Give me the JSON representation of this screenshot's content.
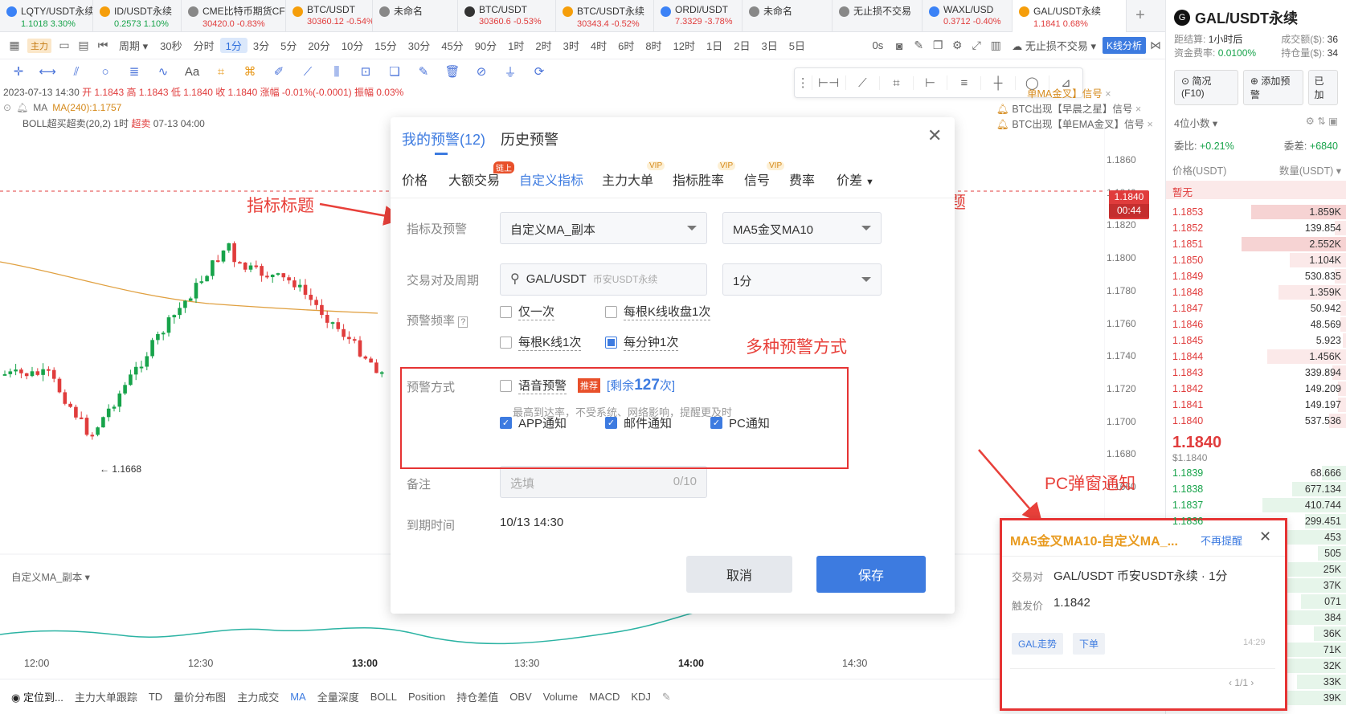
{
  "tabs": [
    {
      "name": "LQTY/USDT永续",
      "price": "1.1018",
      "change": "3.30%",
      "dir": "up",
      "color": "#3b82f6",
      "w": 116
    },
    {
      "name": "ID/USDT永续",
      "price": "0.2573",
      "change": "1.10%",
      "dir": "up",
      "color": "#f59e0b",
      "w": 110
    },
    {
      "name": "CME比特币期货CF",
      "price": "30420.0",
      "change": "-0.83%",
      "dir": "dn",
      "color": "#888",
      "w": 130
    },
    {
      "name": "BTC/USDT",
      "price": "30360.12",
      "change": "-0.54%",
      "dir": "dn",
      "color": "#f59e0b",
      "w": 108
    },
    {
      "name": "未命名",
      "price": "",
      "change": "",
      "dir": "",
      "color": "#888",
      "w": 106
    },
    {
      "name": "BTC/USDT",
      "price": "30360.6",
      "change": "-0.53%",
      "dir": "dn",
      "color": "#333",
      "w": 122
    },
    {
      "name": "BTC/USDT永续",
      "price": "30343.4",
      "change": "-0.52%",
      "dir": "dn",
      "color": "#f59e0b",
      "w": 122
    },
    {
      "name": "ORDI/USDT",
      "price": "7.3329",
      "change": "-3.78%",
      "dir": "dn",
      "color": "#3b82f6",
      "w": 110
    },
    {
      "name": "未命名",
      "price": "",
      "change": "",
      "dir": "",
      "color": "#888",
      "w": 112
    },
    {
      "name": "无止损不交易",
      "price": "",
      "change": "",
      "dir": "",
      "color": "#888",
      "w": 112
    },
    {
      "name": "WAXL/USD",
      "price": "0.3712",
      "change": "-0.40%",
      "dir": "dn",
      "color": "#3b82f6",
      "w": 112
    },
    {
      "name": "GAL/USDT永续",
      "price": "1.1841",
      "change": "0.68%",
      "dir": "dn",
      "color": "#f59e0b",
      "w": 142
    }
  ],
  "toolbar": {
    "main_label": "主力",
    "period_label": "周期",
    "intervals": [
      "30秒",
      "分时",
      "1分",
      "3分",
      "5分",
      "20分",
      "10分",
      "15分",
      "30分",
      "45分",
      "90分",
      "1时",
      "2时",
      "3时",
      "4时",
      "6时",
      "8时",
      "12时",
      "1日",
      "2日",
      "3日",
      "5日"
    ],
    "selected_interval": "1分",
    "seconds_label": "0s",
    "strategy_label": "无止损不交易",
    "kline_btn": "K线分析"
  },
  "legend": {
    "date": "2023-07-13 14:30",
    "ohlc": "开 1.1843 高 1.1843 低 1.1840 收 1.1840 涨幅 -0.01%(-0.0001) 振幅 0.03%",
    "ma_label": "MA",
    "ma_value": "MA(240):1.1757",
    "boll": "BOLL超买超卖(20,2) 1时",
    "boll_tag": "超卖",
    "boll_time": "07-13 04:00"
  },
  "signals": [
    "单MA金叉】信号",
    "BTC出现【早晨之星】信号",
    "BTC出现【单EMA金叉】信号"
  ],
  "price_axis": [
    "1.1860",
    "1.1840",
    "1.1820",
    "1.1800",
    "1.1780",
    "1.1760",
    "1.1740",
    "1.1720",
    "1.1700",
    "1.1680",
    "1.1660"
  ],
  "current_price": "1.1840",
  "countdown": "00:44",
  "low_marker": "1.1668",
  "sub_indicator": "自定义MA_副本",
  "time_axis": [
    "12:00",
    "12:30",
    "13:00",
    "13:30",
    "14:00",
    "14:30"
  ],
  "bottom_bar": [
    "定位到...",
    "主力大单跟踪",
    "TD",
    "量价分布图",
    "主力成交",
    "MA",
    "全量深度",
    "BOLL",
    "Position",
    "持仓差值",
    "OBV",
    "Volume",
    "MACD",
    "KDJ"
  ],
  "right_panel": {
    "title": "GAL/USDT永续",
    "settle_label": "距结算:",
    "settle_value": "1小时后",
    "volume_label": "成交额($):",
    "volume_value": "36",
    "fee_label": "资金费率:",
    "fee_value": "0.0100%",
    "oi_label": "持仓量($):",
    "oi_value": "34",
    "btn1": "简况(F10)",
    "btn2": "添加预警",
    "btn3": "已加",
    "decimals": "4位小数",
    "ratio_label": "委比:",
    "ratio_value": "+0.21%",
    "diff_label": "委差:",
    "diff_value": "+6840",
    "col_price": "价格(USDT)",
    "col_qty": "数量(USDT)",
    "none_label": "暂无",
    "asks": [
      {
        "p": "1.1853",
        "q": "1.859K",
        "w": 0.84,
        "hl": 1
      },
      {
        "p": "1.1852",
        "q": "139.854",
        "w": 0.1,
        "hl": 0
      },
      {
        "p": "1.1851",
        "q": "2.552K",
        "w": 0.93,
        "hl": 1
      },
      {
        "p": "1.1850",
        "q": "1.104K",
        "w": 0.5,
        "hl": 0
      },
      {
        "p": "1.1849",
        "q": "530.835",
        "w": 0.1,
        "hl": 0
      },
      {
        "p": "1.1848",
        "q": "1.359K",
        "w": 0.6,
        "hl": 0
      },
      {
        "p": "1.1847",
        "q": "50.942",
        "w": 0.05,
        "hl": 0
      },
      {
        "p": "1.1846",
        "q": "48.569",
        "w": 0.05,
        "hl": 0
      },
      {
        "p": "1.1845",
        "q": "5.923",
        "w": 0.03,
        "hl": 0
      },
      {
        "p": "1.1844",
        "q": "1.456K",
        "w": 0.7,
        "hl": 0
      },
      {
        "p": "1.1843",
        "q": "339.894",
        "w": 0.12,
        "hl": 0
      },
      {
        "p": "1.1842",
        "q": "149.209",
        "w": 0.07,
        "hl": 0
      },
      {
        "p": "1.1841",
        "q": "149.197",
        "w": 0.07,
        "hl": 0
      },
      {
        "p": "1.1840",
        "q": "537.536",
        "w": 0.15,
        "hl": 0
      }
    ],
    "last_price": "1.1840",
    "last_usd": "$1.1840",
    "bids": [
      {
        "p": "1.1839",
        "q": "68.666"
      },
      {
        "p": "1.1838",
        "q": "677.134"
      },
      {
        "p": "1.1837",
        "q": "410.744"
      },
      {
        "p": "1.1836",
        "q": "299.451"
      },
      {
        "p": "",
        "q": "453"
      },
      {
        "p": "",
        "q": "505"
      },
      {
        "p": "",
        "q": "25K"
      },
      {
        "p": "",
        "q": "37K"
      },
      {
        "p": "",
        "q": "071"
      },
      {
        "p": "",
        "q": "384"
      },
      {
        "p": "",
        "q": "36K"
      },
      {
        "p": "",
        "q": "71K"
      },
      {
        "p": "",
        "q": "32K"
      },
      {
        "p": "",
        "q": "33K"
      },
      {
        "p": "",
        "q": "39K"
      }
    ]
  },
  "dialog": {
    "tab_active": "我的预警(12)",
    "tab_history": "历史预警",
    "subtabs": [
      "价格",
      "大额交易",
      "自定义指标",
      "主力大单",
      "指标胜率",
      "信号",
      "费率",
      "价差"
    ],
    "badge_chain": "链上",
    "badge_vip": "VIP",
    "indicator_label": "指标及预警",
    "indicator_value": "自定义MA_副本",
    "alert_title_value": "MA5金叉MA10",
    "pair_label": "交易对及周期",
    "pair_value": "GAL/USDT",
    "pair_sub": "币安USDT永续",
    "period_value": "1分",
    "freq_label": "预警频率",
    "freq_options": [
      {
        "text": "仅一次",
        "state": "off"
      },
      {
        "text": "每根K线收盘1次",
        "state": "off"
      },
      {
        "text": "每根K线1次",
        "state": "off"
      },
      {
        "text": "每分钟1次",
        "state": "half"
      }
    ],
    "method_label": "预警方式",
    "voice_label": "语音预警",
    "recommend": "推荐",
    "remain_prefix": "[剩余",
    "remain_count": "127",
    "remain_suffix": "次]",
    "voice_hint": "最高到达率，不受系统、网络影响，提醒更及时",
    "notify_options": [
      "APP通知",
      "邮件通知",
      "PC通知"
    ],
    "note_label": "备注",
    "note_placeholder": "选填",
    "note_count": "0/10",
    "expire_label": "到期时间",
    "expire_value": "10/13 14:30",
    "cancel": "取消",
    "save": "保存"
  },
  "notice": {
    "title": "MA5金叉MA10-自定义MA_...",
    "no_remind": "不再提醒",
    "pair_label": "交易对",
    "pair_value": "GAL/USDT 币安USDT永续 · 1分",
    "trigger_label": "触发价",
    "trigger_value": "1.1842",
    "chip1": "GAL走势",
    "chip2": "下单",
    "time": "14:29",
    "pager": "1/1"
  },
  "annotations": {
    "indicator_title": "指标标题",
    "alert_title": "预警标题",
    "multi_method": "多种预警方式",
    "pc_popup": "PC弹窗通知"
  },
  "colors": {
    "accent": "#3d7be0",
    "up": "#17a34a",
    "down": "#e03c3c",
    "annotation": "#e8403a"
  }
}
